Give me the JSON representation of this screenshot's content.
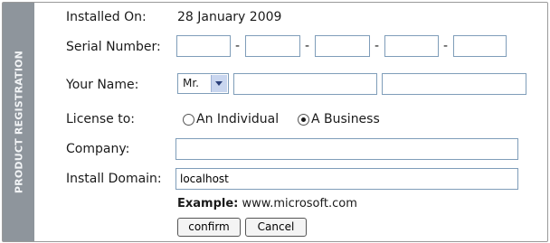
{
  "sidebar": {
    "label": "PRODUCT REGISTRATION"
  },
  "installed": {
    "label": "Installed On:",
    "value": "28 January 2009"
  },
  "serial": {
    "label": "Serial Number:",
    "segments": [
      "",
      "",
      "",
      "",
      ""
    ],
    "separator": "-"
  },
  "name": {
    "label": "Your Name:",
    "title_value": "Mr.",
    "first": "",
    "last": ""
  },
  "license": {
    "label": "License to:",
    "options": [
      "An Individual",
      "A Business"
    ],
    "selected": "A Business"
  },
  "company": {
    "label": "Company:",
    "value": ""
  },
  "domain": {
    "label": "Install Domain:",
    "value": "localhost"
  },
  "example": {
    "prefix": "Example:",
    "text": "www.microsoft.com"
  },
  "buttons": {
    "confirm": "confirm",
    "cancel": "Cancel"
  },
  "colors": {
    "sidebar": "#8e959c",
    "field_border": "#7f9db9"
  }
}
